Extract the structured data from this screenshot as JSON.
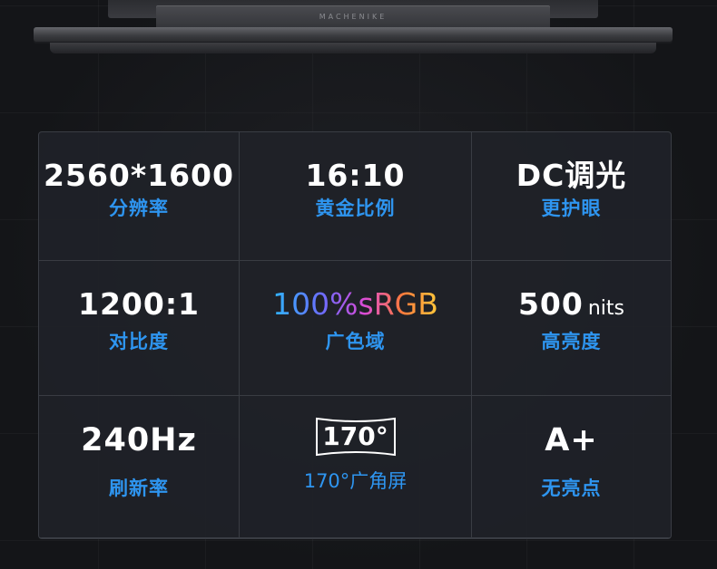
{
  "brand": "MACHENIKE",
  "specs": [
    {
      "value": "2560*1600",
      "label": "分辨率"
    },
    {
      "value": "16:10",
      "label": "黄金比例"
    },
    {
      "value": "DC调光",
      "label": "更护眼"
    },
    {
      "value": "1200:1",
      "label": "对比度"
    },
    {
      "value": "100%sRGB",
      "label": "广色域"
    },
    {
      "value": "500",
      "unit": "nits",
      "label": "高亮度"
    },
    {
      "value": "240Hz",
      "label": "刷新率"
    },
    {
      "value": "170°",
      "label": "170°广角屏"
    },
    {
      "value": "A+",
      "label": "无亮点"
    }
  ],
  "colors": {
    "background": "#141518",
    "panel": "#202228",
    "value_text": "#ffffff",
    "label_text": "#2e95f0",
    "srgb_gradient": [
      "#2fb6ff",
      "#6b6dff",
      "#d94bd8",
      "#ff7a3c",
      "#ffc83a"
    ]
  }
}
